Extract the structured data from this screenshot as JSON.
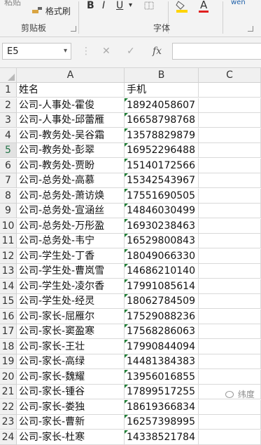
{
  "ribbon": {
    "paste_label": "粘贴",
    "format_painter_label": "格式刷",
    "clipboard_group": "剪贴板",
    "font_group": "字体",
    "bold": "B",
    "italic": "I",
    "underline": "U",
    "underline_menu": "▾",
    "font_color_letter": "A",
    "phonetic_label": "wén",
    "accent_fill": "#ffd400",
    "accent_font": "#e02020"
  },
  "formula_bar": {
    "name_box": "E5",
    "cancel": "✕",
    "confirm": "✓",
    "fx": "fx",
    "value": ""
  },
  "columns": [
    "A",
    "B",
    "C"
  ],
  "rows": [
    {
      "num": "1",
      "a": "姓名",
      "b": "手机"
    },
    {
      "num": "2",
      "a": "公司-人事处-霍俊",
      "b": "18924058607"
    },
    {
      "num": "3",
      "a": "公司-人事处-邱蕾雁",
      "b": "16658798768"
    },
    {
      "num": "4",
      "a": "公司-教务处-吴谷霜",
      "b": "13578829879"
    },
    {
      "num": "5",
      "a": "公司-教务处-彭翠",
      "b": "16952296488"
    },
    {
      "num": "6",
      "a": "公司-教务处-贾盼",
      "b": "15140172566"
    },
    {
      "num": "7",
      "a": "公司-总务处-高慕",
      "b": "15342543967"
    },
    {
      "num": "8",
      "a": "公司-总务处-萧访焕",
      "b": "17551690505"
    },
    {
      "num": "9",
      "a": "公司-总务处-宣涵丝",
      "b": "14846030499"
    },
    {
      "num": "10",
      "a": "公司-总务处-万彤盈",
      "b": "16930238463"
    },
    {
      "num": "11",
      "a": "公司-总务处-韦宁",
      "b": "16529800843"
    },
    {
      "num": "12",
      "a": "公司-学生处-丁香",
      "b": "18049066330"
    },
    {
      "num": "13",
      "a": "公司-学生处-曹岚雪",
      "b": "14686210140"
    },
    {
      "num": "14",
      "a": "公司-学生处-凌尔香",
      "b": "17991085614"
    },
    {
      "num": "15",
      "a": "公司-学生处-经灵",
      "b": "18062784509"
    },
    {
      "num": "16",
      "a": "公司-家长-屈雁尔",
      "b": "17529088236"
    },
    {
      "num": "17",
      "a": "公司-家长-窦盈寒",
      "b": "17568286063"
    },
    {
      "num": "18",
      "a": "公司-家长-王壮",
      "b": "17990844094"
    },
    {
      "num": "19",
      "a": "公司-家长-高绿",
      "b": "14481384383"
    },
    {
      "num": "20",
      "a": "公司-家长-魏耀",
      "b": "13956016855"
    },
    {
      "num": "21",
      "a": "公司-家长-锺谷",
      "b": "17899517255"
    },
    {
      "num": "22",
      "a": "公司-家长-娄独",
      "b": "18619366834"
    },
    {
      "num": "23",
      "a": "公司-家长-曹新",
      "b": "16257398995"
    },
    {
      "num": "24",
      "a": "公司-家长-杜寒",
      "b": "14338521784"
    }
  ],
  "watermark": "纬度"
}
